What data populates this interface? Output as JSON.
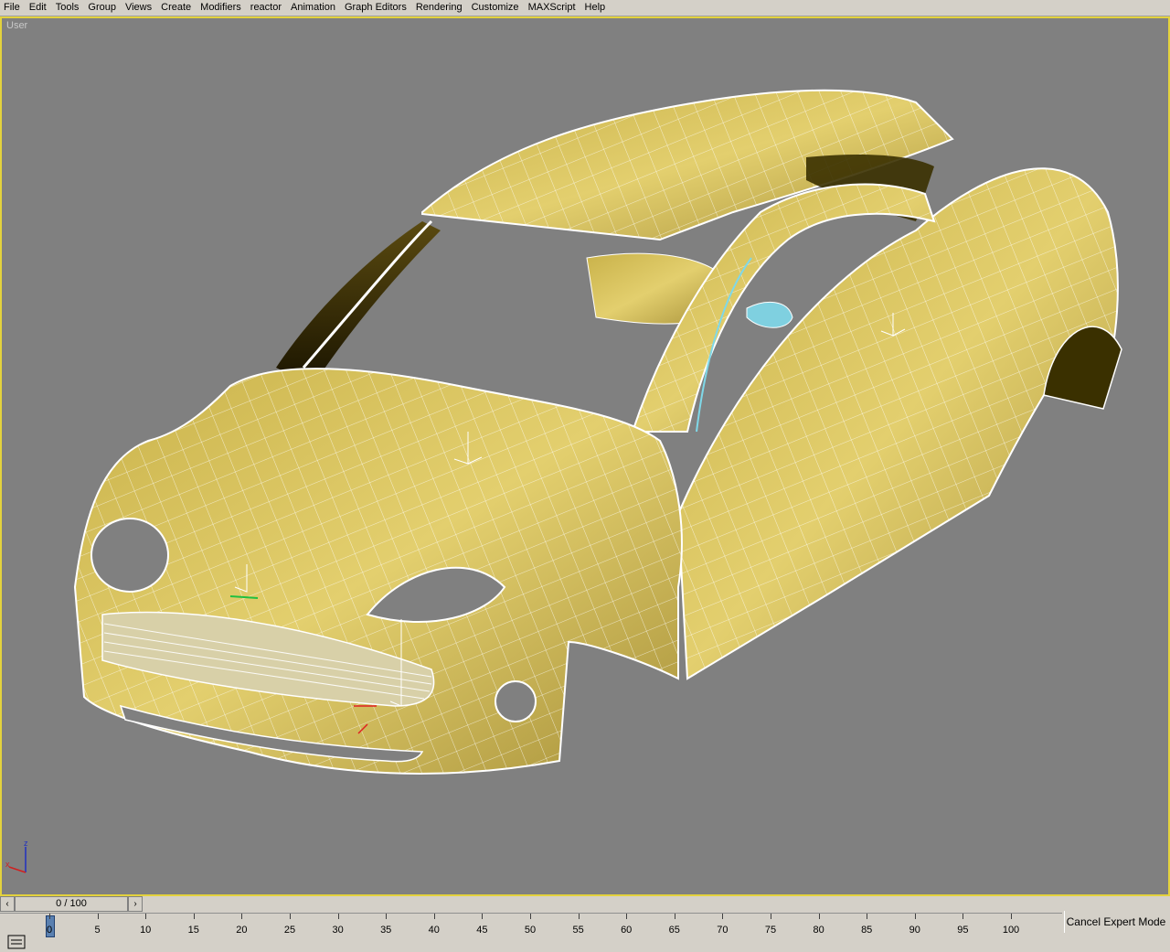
{
  "menu": [
    "File",
    "Edit",
    "Tools",
    "Group",
    "Views",
    "Create",
    "Modifiers",
    "reactor",
    "Animation",
    "Graph Editors",
    "Rendering",
    "Customize",
    "MAXScript",
    "Help"
  ],
  "viewport": {
    "label": "User",
    "border_color": "#e3d23d",
    "background": "#808080",
    "model_color": "#d9c25a"
  },
  "axis": {
    "x": "x",
    "z": "z"
  },
  "time_slider": {
    "position": "0 / 100",
    "prev_icon": "chevron-left-icon",
    "next_icon": "chevron-right-icon"
  },
  "track_ruler": {
    "ticks": [
      "0",
      "5",
      "10",
      "15",
      "20",
      "25",
      "30",
      "35",
      "40",
      "45",
      "50",
      "55",
      "60",
      "65",
      "70",
      "75",
      "80",
      "85",
      "90",
      "95",
      "100"
    ]
  },
  "expert_mode_button": "Cancel Expert Mode"
}
